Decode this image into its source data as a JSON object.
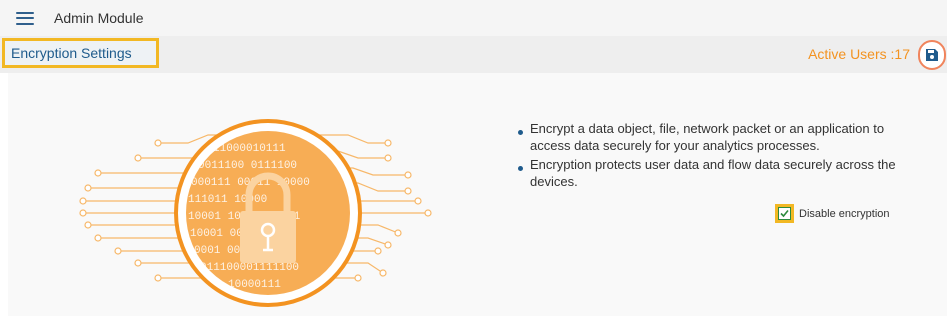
{
  "header": {
    "app_title": "Admin Module",
    "menu_icon": "hamburger-icon"
  },
  "toolbar": {
    "section_title": "Encryption Settings",
    "active_users": "Active Users :17",
    "save_icon": "save-icon"
  },
  "content": {
    "bullets": [
      "Encrypt a data object, file, network packet or an application to access data securely for your analytics processes.",
      "Encryption protects user data and flow data securely across the devices."
    ],
    "checkbox": {
      "label": "Disable encryption",
      "checked": true
    },
    "illustration": {
      "icon": "padlock-circuit-icon",
      "binary_lines": [
        "11000010111",
        "0011100 0111100",
        "000111 00011 10000",
        "111011 10000",
        "10001 100 1 00001",
        "10001 0001",
        "0001 0000",
        "011100001111100",
        "10000111"
      ]
    }
  },
  "colors": {
    "accent": "#f39321",
    "highlight": "#f2b824",
    "brand": "#1f5b8c",
    "check": "#2e8b3e"
  }
}
